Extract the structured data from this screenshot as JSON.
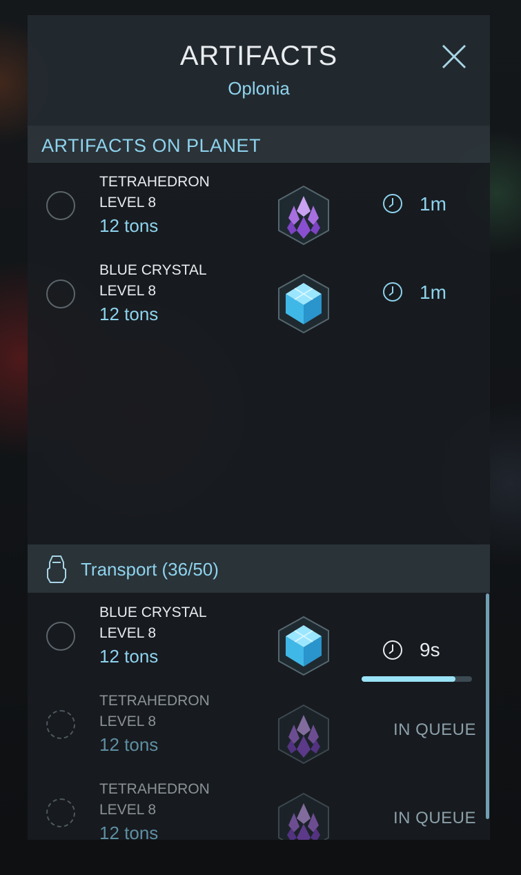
{
  "header": {
    "title": "ARTIFACTS",
    "subtitle": "Oplonia"
  },
  "planet_section": {
    "title": "ARTIFACTS ON PLANET",
    "items": [
      {
        "name": "TETRAHEDRON",
        "level": "LEVEL 8",
        "weight": "12 tons",
        "icon": "tetrahedron-icon",
        "time": "1m"
      },
      {
        "name": "BLUE CRYSTAL",
        "level": "LEVEL 8",
        "weight": "12 tons",
        "icon": "blue-crystal-icon",
        "time": "1m"
      }
    ]
  },
  "transport_section": {
    "title": "Transport (36/50)",
    "items": [
      {
        "name": "BLUE CRYSTAL",
        "level": "LEVEL 8",
        "weight": "12 tons",
        "icon": "blue-crystal-icon",
        "time": "9s",
        "progress": 0.85
      },
      {
        "name": "TETRAHEDRON",
        "level": "LEVEL 8",
        "weight": "12 tons",
        "icon": "tetrahedron-icon",
        "status": "IN QUEUE"
      },
      {
        "name": "TETRAHEDRON",
        "level": "LEVEL 8",
        "weight": "12 tons",
        "icon": "tetrahedron-icon",
        "status": "IN QUEUE"
      }
    ]
  },
  "colors": {
    "accent": "#8ed3ee",
    "progress": "#9ae2f6",
    "tetrahedron": "#a060d8",
    "crystal": "#4fc8f0"
  }
}
